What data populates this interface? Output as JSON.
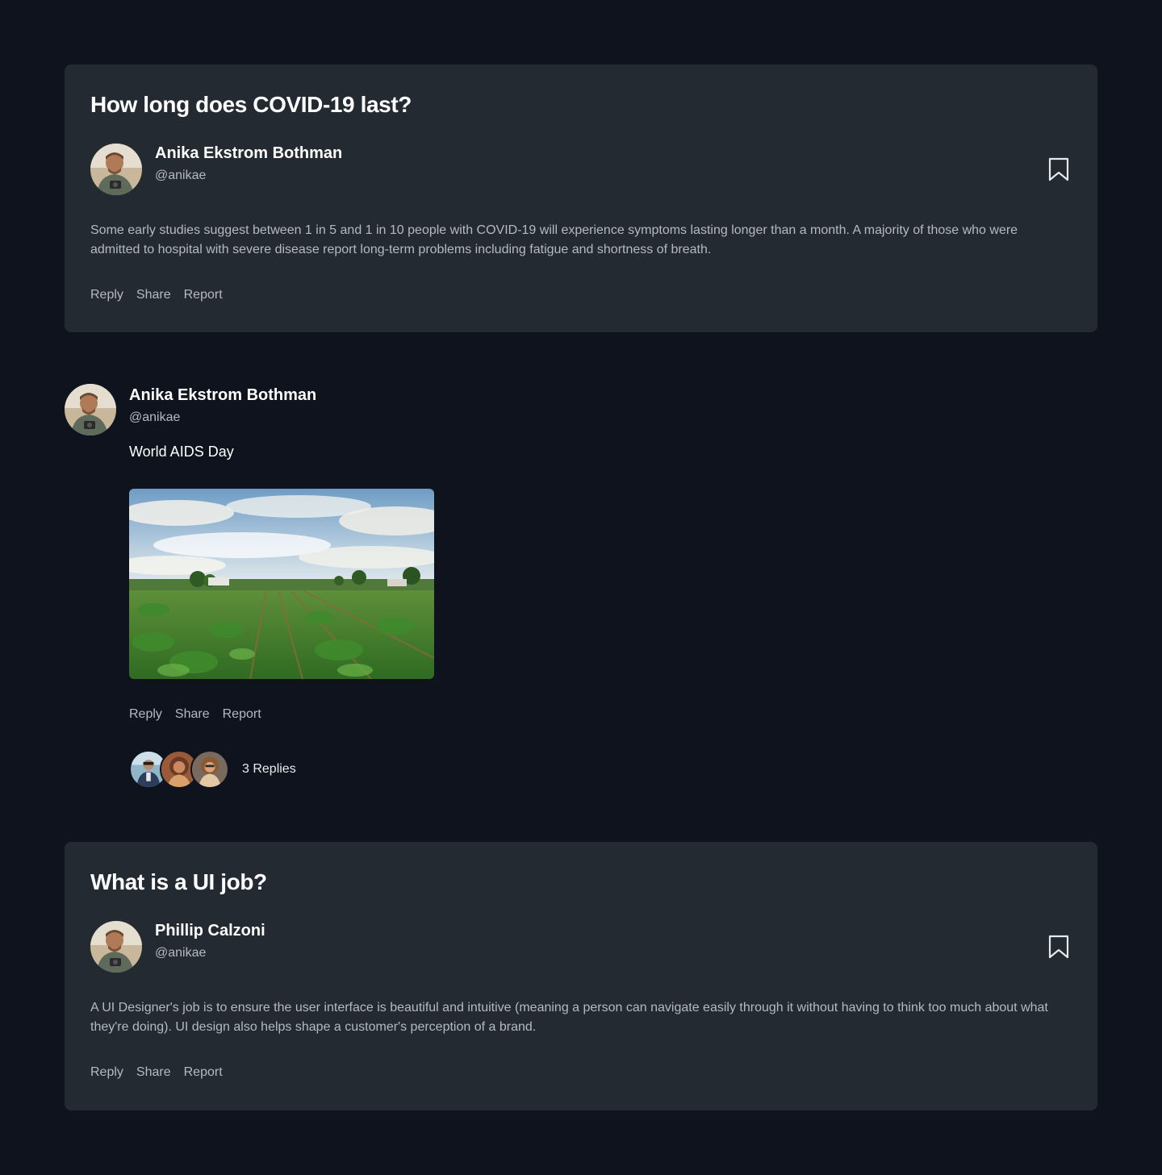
{
  "threads": [
    {
      "title": "How long does COVID-19 last?",
      "author_name": "Anika Ekstrom Bothman",
      "author_handle": "@anikae",
      "body": "Some early studies suggest between 1 in 5 and 1 in 10 people with COVID-19 will experience symptoms lasting longer than a month. A majority of those who were admitted to hospital with severe disease report long-term problems including fatigue and shortness of breath.",
      "actions": [
        "Reply",
        "Share",
        "Report"
      ]
    },
    {
      "title": "What is a UI job?",
      "author_name": "Phillip Calzoni",
      "author_handle": "@anikae",
      "body": "A UI Designer's job is to ensure the user interface is beautiful and intuitive (meaning a person can navigate easily through it without having to think too much about what they're doing). UI design also helps shape a customer's perception of a brand.",
      "actions": [
        "Reply",
        "Share",
        "Report"
      ]
    }
  ],
  "post": {
    "author_name": "Anika Ekstrom Bothman",
    "author_handle": "@anikae",
    "text": "World AIDS Day",
    "actions": [
      "Reply",
      "Share",
      "Report"
    ],
    "replies_label": "3 Replies"
  },
  "icons": {
    "bookmark": "bookmark-icon"
  },
  "colors": {
    "background": "#0e131e",
    "card": "#232a32",
    "muted_text": "#b5bac1",
    "text": "#ffffff"
  }
}
